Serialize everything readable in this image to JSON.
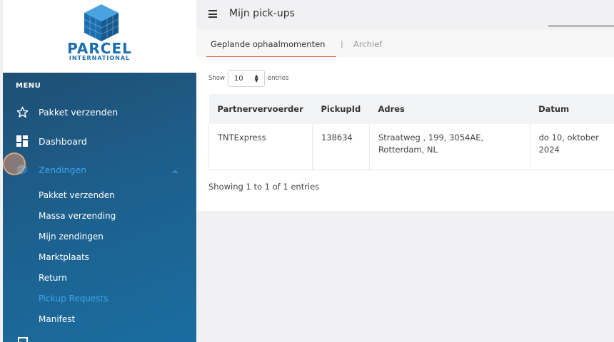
{
  "brand": {
    "name": "PARCEL",
    "tagline": "INTERNATIONAL"
  },
  "menu": {
    "heading": "MENU",
    "items": [
      {
        "label": "Pakket verzenden",
        "icon": "star-icon"
      },
      {
        "label": "Dashboard",
        "icon": "dashboard-icon"
      },
      {
        "label": "Zendingen",
        "icon": "box-icon",
        "active": true
      }
    ],
    "sub_items": [
      {
        "label": "Pakket verzenden"
      },
      {
        "label": "Massa verzending"
      },
      {
        "label": "Mijn zendingen"
      },
      {
        "label": "Marktplaats"
      },
      {
        "label": "Return"
      },
      {
        "label": "Pickup Requests",
        "active": true
      },
      {
        "label": "Manifest"
      }
    ]
  },
  "header": {
    "title": "Mijn pick-ups"
  },
  "tabs": [
    {
      "label": "Geplande ophaalmomenten",
      "active": true
    },
    {
      "label": "Archief"
    }
  ],
  "table_controls": {
    "show_label": "Show",
    "page_size": "10",
    "entries_label": "entries"
  },
  "table": {
    "columns": [
      "Partnervervoerder",
      "PickupId",
      "Adres",
      "Datum"
    ],
    "rows": [
      {
        "partner": "TNTExpress",
        "pickup_id": "138634",
        "address_line1": "Straatweg , 199, 3054AE,",
        "address_line2": "Rotterdam, NL",
        "date_line1": "do 10, oktober",
        "date_line2": "2024"
      }
    ]
  },
  "info": "Showing 1 to 1 of 1 entries",
  "colors": {
    "brand_blue": "#1b6fb0",
    "sidebar_gradient_start": "#1f4f73",
    "sidebar_gradient_end": "#1a6da1",
    "active_link": "#3ba6ef",
    "tab_underline": "#e25a3b"
  }
}
